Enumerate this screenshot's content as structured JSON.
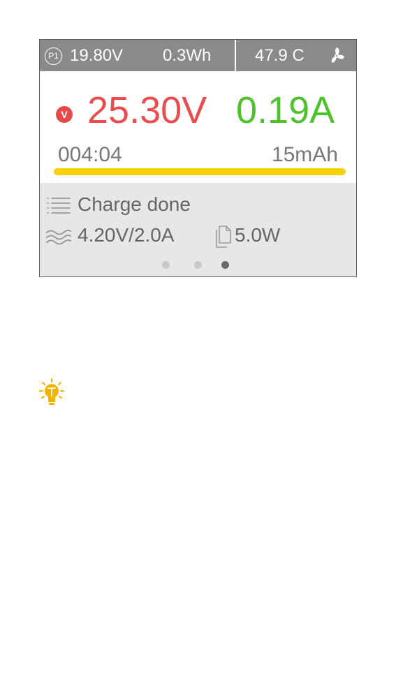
{
  "topbar": {
    "port": "P1",
    "input_voltage": "19.80V",
    "energy": "0.3Wh",
    "temperature": "47.9 C",
    "fan_icon": "fan-icon"
  },
  "main": {
    "mode_badge": "V",
    "voltage": "25.30V",
    "current": "0.19A",
    "timer": "004:04",
    "capacity": "15mAh",
    "progress_percent": 100
  },
  "info": {
    "status": "Charge done",
    "charge_setting": "4.20V/2.0A",
    "power": "5.0W",
    "page_count": 3,
    "active_page": 3
  },
  "colors": {
    "topbar": "#8a8a8a",
    "voltage": "#e84e4f",
    "current": "#4ec12d",
    "progress": "#f7d100",
    "info_bg": "#e7e7e7",
    "tip": "#f0b400"
  }
}
